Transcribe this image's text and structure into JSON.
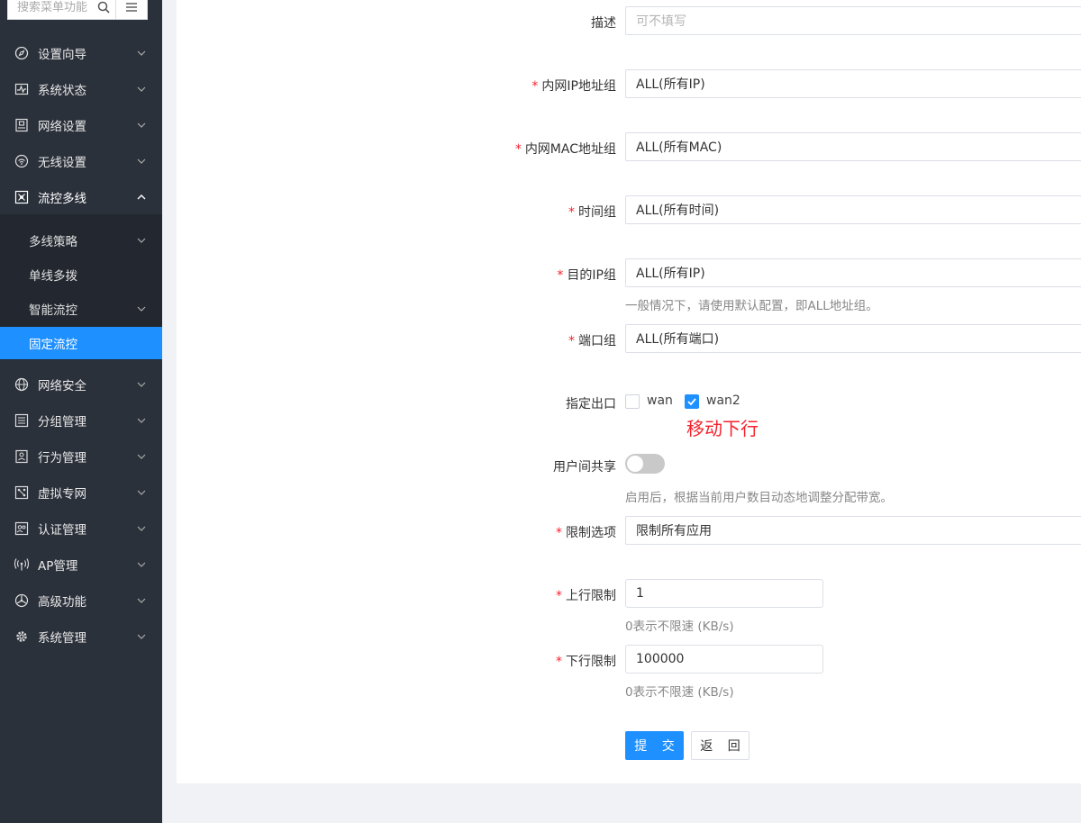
{
  "sidebar": {
    "search_placeholder": "搜索菜单功能",
    "items": [
      {
        "label": "设置向导"
      },
      {
        "label": "系统状态"
      },
      {
        "label": "网络设置"
      },
      {
        "label": "无线设置"
      },
      {
        "label": "流控多线"
      },
      {
        "label": "网络安全"
      },
      {
        "label": "分组管理"
      },
      {
        "label": "行为管理"
      },
      {
        "label": "虚拟专网"
      },
      {
        "label": "认证管理"
      },
      {
        "label": "AP管理"
      },
      {
        "label": "高级功能"
      },
      {
        "label": "系统管理"
      }
    ],
    "submenu": [
      {
        "label": "多线策略"
      },
      {
        "label": "单线多拨"
      },
      {
        "label": "智能流控"
      },
      {
        "label": "固定流控"
      }
    ]
  },
  "form": {
    "desc": {
      "label": "描述",
      "placeholder": "可不填写"
    },
    "lan_ip_group": {
      "label": "内网IP地址组",
      "value": "ALL(所有IP)"
    },
    "lan_mac_group": {
      "label": "内网MAC地址组",
      "value": "ALL(所有MAC)"
    },
    "time_group": {
      "label": "时间组",
      "value": "ALL(所有时间)"
    },
    "dest_ip_group": {
      "label": "目的IP组",
      "value": "ALL(所有IP)",
      "hint": "一般情况下，请使用默认配置，即ALL地址组。"
    },
    "port_group": {
      "label": "端口组",
      "value": "ALL(所有端口)"
    },
    "exit": {
      "label": "指定出口",
      "options": [
        {
          "label": "wan",
          "checked": false
        },
        {
          "label": "wan2",
          "checked": true
        }
      ],
      "note": "移动下行"
    },
    "share": {
      "label": "用户间共享",
      "enabled": false,
      "hint": "启用后，根据当前用户数目动态地调整分配带宽。"
    },
    "limit_option": {
      "label": "限制选项",
      "value": "限制所有应用"
    },
    "up_limit": {
      "label": "上行限制",
      "value": "1",
      "hint": "0表示不限速 (KB/s)"
    },
    "down_limit": {
      "label": "下行限制",
      "value": "100000",
      "hint": "0表示不限速 (KB/s)"
    },
    "required_mark": "*"
  },
  "buttons": {
    "submit": "提 交",
    "back": "返 回"
  },
  "colors": {
    "sidebar_bg": "#2b313b",
    "active": "#1e90ff",
    "required": "#f5222d"
  }
}
